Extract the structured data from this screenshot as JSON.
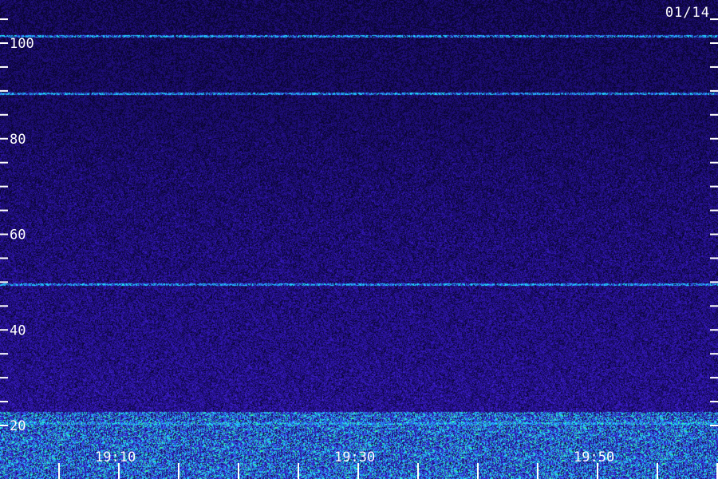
{
  "date_label": "01/14",
  "chart_data": {
    "type": "heatmap",
    "title": "",
    "xlabel": "",
    "ylabel": "",
    "x_range": [
      "19:00",
      "20:00"
    ],
    "xlim": [
      "19:00",
      "20:00"
    ],
    "ylim": [
      15,
      115
    ],
    "y_ticks": [
      20,
      25,
      30,
      35,
      40,
      45,
      50,
      55,
      60,
      65,
      70,
      75,
      80,
      85,
      90,
      95,
      100,
      105,
      110
    ],
    "y_tick_labels": [
      "20",
      "40",
      "60",
      "80",
      "100"
    ],
    "x_ticks": [
      "19:00",
      "19:05",
      "19:10",
      "19:15",
      "19:20",
      "19:25",
      "19:30",
      "19:35",
      "19:40",
      "19:45",
      "19:50",
      "19:55",
      "20:00"
    ],
    "x_tick_labels": [
      "19:10",
      "19:30",
      "19:50"
    ],
    "bright_lines_y": [
      20.5,
      49.5,
      89.5,
      101.5
    ],
    "colors": {
      "background": "#1c0c6a",
      "low": "#0a0540",
      "mid": "#3a1fd0",
      "high": "#1fb5ff",
      "peak": "#3cff90"
    }
  }
}
